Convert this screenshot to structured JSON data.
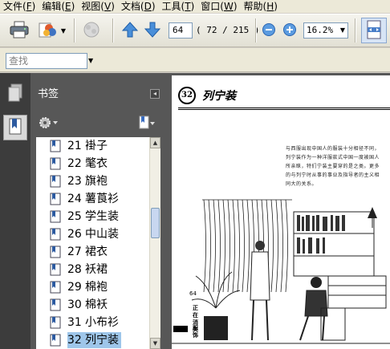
{
  "menubar": [
    {
      "label": "文件",
      "key": "F"
    },
    {
      "label": "编辑",
      "key": "E"
    },
    {
      "label": "视图",
      "key": "V"
    },
    {
      "label": "文档",
      "key": "D"
    },
    {
      "label": "工具",
      "key": "T"
    },
    {
      "label": "窗口",
      "key": "W"
    },
    {
      "label": "帮助",
      "key": "H"
    }
  ],
  "toolbar": {
    "current_page": "64",
    "page_total": "( 72 / 215 )",
    "zoom": "16.2%"
  },
  "search": {
    "placeholder": "查找"
  },
  "bookmarks": {
    "title": "书签",
    "items": [
      {
        "num": "21",
        "label": "褂子"
      },
      {
        "num": "22",
        "label": "氅衣"
      },
      {
        "num": "23",
        "label": "旗袍"
      },
      {
        "num": "24",
        "label": "薯莨衫"
      },
      {
        "num": "25",
        "label": "学生装"
      },
      {
        "num": "26",
        "label": "中山装"
      },
      {
        "num": "27",
        "label": "裙衣"
      },
      {
        "num": "28",
        "label": "袄裙"
      },
      {
        "num": "29",
        "label": "棉袍"
      },
      {
        "num": "30",
        "label": "棉袄"
      },
      {
        "num": "31",
        "label": "小布衫"
      },
      {
        "num": "32",
        "label": "列宁装"
      }
    ],
    "selected_index": 11
  },
  "page": {
    "chapter_num": "32",
    "chapter_title": "列宁装",
    "body": "与西服出现中国人的服装十分相径不同，列宁装作为一种洋服款式中国一度被国人所亲睐，特们宁装主要穿的是之类。更多的与列宁时从事的事业及指导者的主义相同大的关系。",
    "page_number": "64",
    "side_label_top": "正在消失",
    "side_label_bottom": "服饰"
  }
}
